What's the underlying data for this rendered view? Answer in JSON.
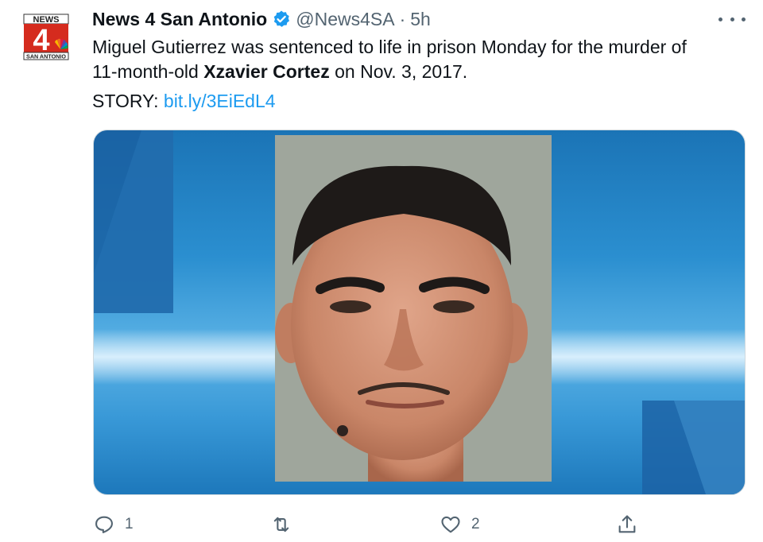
{
  "tweet": {
    "author_name": "News 4 San Antonio",
    "handle": "@News4SA",
    "separator": "·",
    "time": "5h",
    "text_line1": "Miguel Gutierrez was sentenced to life in prison Monday for the murder of",
    "text_line2_pre": "11-month-old ",
    "text_line2_bold": "Xzavier Cortez",
    "text_line2_post": " on Nov. 3, 2017.",
    "story_label": "STORY: ",
    "story_link": "bit.ly/3EiEdL4"
  },
  "logo": {
    "top_text": "NEWS",
    "number": "4",
    "bottom_text": "SAN ANTONIO"
  },
  "actions": {
    "reply_count": "1",
    "retweet_count": "",
    "like_count": "2"
  },
  "colors": {
    "accent": "#1d9bf0",
    "logo_red": "#d52b1e",
    "muted": "#536471"
  },
  "icons": [
    "verified-badge-icon",
    "more-options-icon",
    "reply-icon",
    "retweet-icon",
    "like-icon",
    "share-icon"
  ]
}
